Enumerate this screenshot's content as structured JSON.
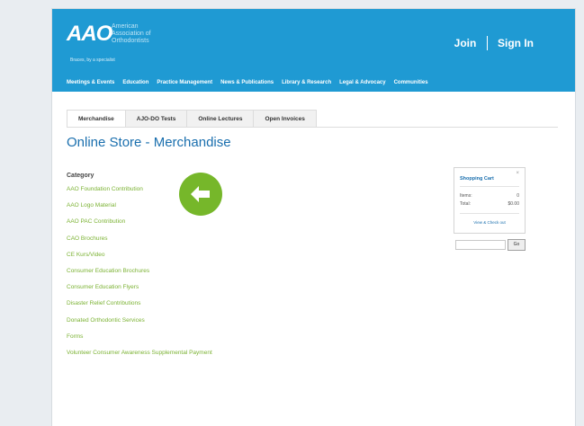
{
  "logo": {
    "mark": "AAO",
    "name_line1": "American",
    "name_line2": "Association of",
    "name_line3": "Orthodontists",
    "tagline": "Braces, by a specialist"
  },
  "auth": {
    "join": "Join",
    "sign_in": "Sign In"
  },
  "nav": {
    "items": [
      {
        "label": "Meetings & Events"
      },
      {
        "label": "Education"
      },
      {
        "label": "Practice Management"
      },
      {
        "label": "News & Publications"
      },
      {
        "label": "Library & Research"
      },
      {
        "label": "Legal & Advocacy"
      },
      {
        "label": "Communities"
      }
    ]
  },
  "tabs": [
    {
      "label": "Merchandise"
    },
    {
      "label": "AJO-DO Tests"
    },
    {
      "label": "Online Lectures"
    },
    {
      "label": "Open Invoices"
    }
  ],
  "page": {
    "title": "Online Store - Merchandise"
  },
  "category": {
    "heading": "Category",
    "items": [
      {
        "label": "AAO Foundation Contribution"
      },
      {
        "label": "AAO Logo Material"
      },
      {
        "label": "AAO PAC Contribution"
      },
      {
        "label": "CAO Brochures"
      },
      {
        "label": "CE Kurs/Video"
      },
      {
        "label": "Consumer Education Brochures"
      },
      {
        "label": "Consumer Education Flyers"
      },
      {
        "label": "Disaster Relief Contributions"
      },
      {
        "label": "Donated Orthodontic Services"
      },
      {
        "label": "Forms"
      },
      {
        "label": "Volunteer Consumer Awareness Supplemental Payment"
      }
    ]
  },
  "cart": {
    "title": "Shopping Cart",
    "items_label": "Items:",
    "items_value": "0",
    "total_label": "Total:",
    "total_value": "$0.00",
    "link": "View & Check out"
  },
  "search": {
    "button": "Go"
  },
  "colors": {
    "header": "#1f9ad3",
    "link_green": "#7bb233",
    "title_blue": "#1a6fae",
    "arrow_green": "#76b72a"
  },
  "icons": {
    "arrow": "arrow-left-icon"
  }
}
